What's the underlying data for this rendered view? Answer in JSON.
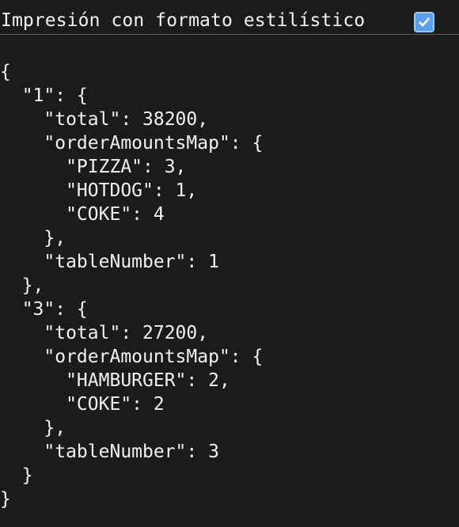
{
  "toolbar": {
    "pretty_print_label": "Impresión con formato estilístico",
    "pretty_print_checked": true,
    "checkbox_color": "#5aa0ee"
  },
  "json_lines": [
    "{",
    "  \"1\": {",
    "    \"total\": 38200,",
    "    \"orderAmountsMap\": {",
    "      \"PIZZA\": 3,",
    "      \"HOTDOG\": 1,",
    "      \"COKE\": 4",
    "    },",
    "    \"tableNumber\": 1",
    "  },",
    "  \"3\": {",
    "    \"total\": 27200,",
    "    \"orderAmountsMap\": {",
    "      \"HAMBURGER\": 2,",
    "      \"COKE\": 2",
    "    },",
    "    \"tableNumber\": 3",
    "  }",
    "}"
  ]
}
